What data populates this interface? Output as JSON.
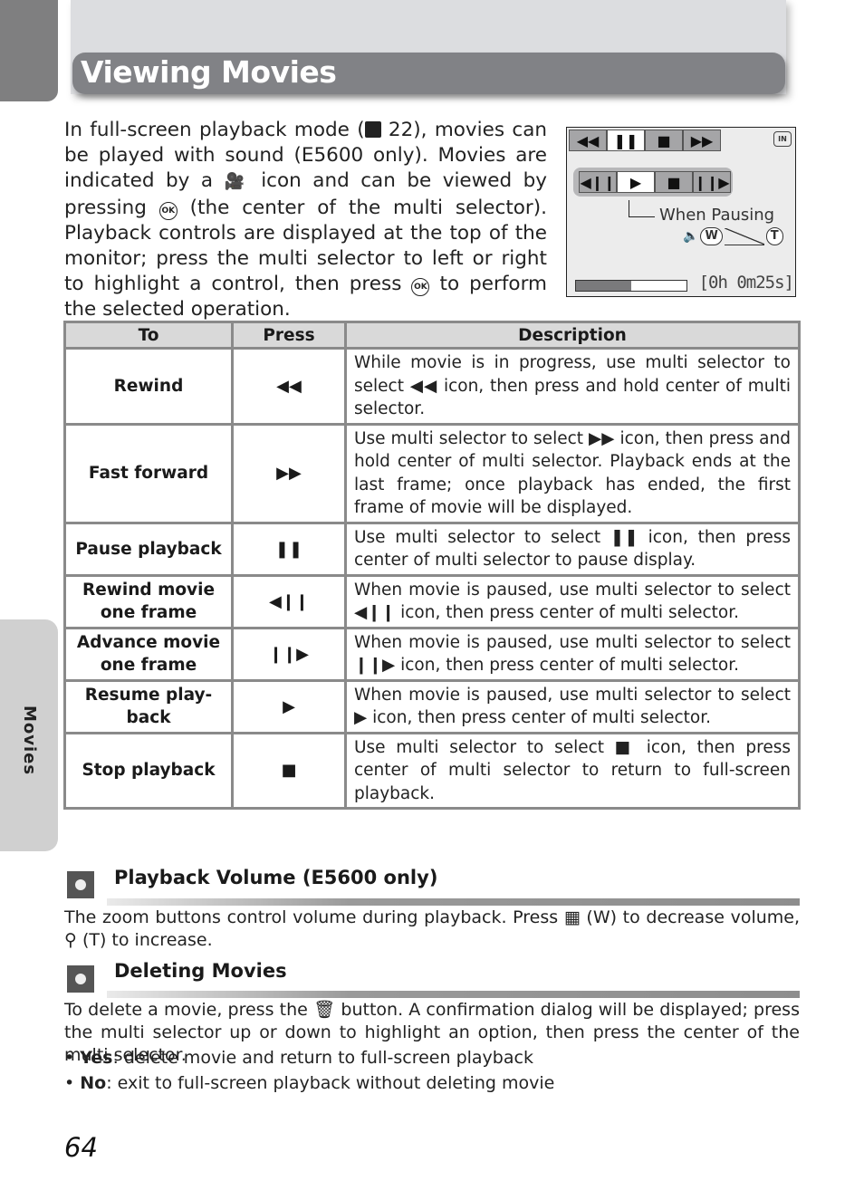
{
  "page": {
    "title": "Viewing Movies",
    "side_tab": "Movies",
    "page_number": "64"
  },
  "intro": {
    "part1": "In full-screen playback mode (",
    "ref_icon": "playback-mode-icon",
    "part2": " 22), movies can be played with sound (E5600 only). Movies are indicated by a ",
    "movie_icon": "movie-camera-icon",
    "part3": " icon and can be viewed by pressing ",
    "ok_label": "OK",
    "part4": " (the center of the multi selector). Playback controls are displayed at the top of the monitor; press the multi selector to left or right to highlight a control, then press ",
    "part5": " to perform the selected operation."
  },
  "monitor": {
    "top_controls": [
      {
        "icon": "rewind-icon",
        "glyph": "◀◀",
        "selected": false
      },
      {
        "icon": "pause-icon",
        "glyph": "❚❚",
        "selected": true
      },
      {
        "icon": "stop-icon",
        "glyph": "■",
        "selected": false
      },
      {
        "icon": "fast-forward-icon",
        "glyph": "▶▶",
        "selected": false
      }
    ],
    "pause_controls": [
      {
        "icon": "frame-back-icon",
        "glyph": "◀❙❙",
        "selected": false
      },
      {
        "icon": "play-icon",
        "glyph": "▶",
        "selected": true
      },
      {
        "icon": "stop-icon",
        "glyph": "■",
        "selected": false
      },
      {
        "icon": "frame-advance-icon",
        "glyph": "❙❙▶",
        "selected": false
      }
    ],
    "memory_label": "IN",
    "when_pausing_label": "When Pausing",
    "volume": {
      "wide": "W",
      "tele": "T"
    },
    "progress_fraction": 0.5,
    "timecode": "[0h 0m25s]"
  },
  "table": {
    "headers": [
      "To",
      "Press",
      "Description"
    ],
    "rows": [
      {
        "to": "Rewind",
        "press": "◀◀",
        "desc": "While movie is in progress, use multi selector to select ◀◀ icon, then press and hold center of multi selector."
      },
      {
        "to": "Fast forward",
        "press": "▶▶",
        "desc": "Use multi selector to select ▶▶ icon, then press and hold center of multi selector. Playback ends at the last frame; once playback has ended, the first frame of movie will be displayed."
      },
      {
        "to": "Pause playback",
        "press": "❚❚",
        "desc": "Use multi selector to select ❚❚ icon, then press center of multi selector to pause display."
      },
      {
        "to": "Rewind movie one frame",
        "press": "◀❙❙",
        "desc": "When movie is paused, use multi selector to select ◀❙❙ icon, then press center of multi selector."
      },
      {
        "to": "Advance movie one frame",
        "press": "❙❙▶",
        "desc": "When movie is paused, use multi selector to select ❙❙▶ icon, then press center of multi selector."
      },
      {
        "to": "Resume play-back",
        "press": "▶",
        "desc": "When movie is paused, use multi selector to select ▶ icon, then press center of multi selector."
      },
      {
        "to": "Stop playback",
        "press": "■",
        "desc": "Use multi selector to select ■ icon, then press center of multi selector to return to full-screen playback."
      }
    ]
  },
  "sections": {
    "volume": {
      "icon": "tip-lightbulb-icon",
      "title": "Playback Volume (E5600 only)",
      "text": "The zoom buttons control volume during playback. Press ▦ (W) to decrease volume, ⚲ (T) to increase."
    },
    "deleting": {
      "icon": "tip-lightbulb-icon",
      "title": "Deleting Movies",
      "text": "To delete a movie, press the 🗑 button. A confirmation dialog will be displayed; press the multi selector up or down to highlight an option, then press the center of the multi selector.",
      "bullets": [
        {
          "term": "Yes",
          "desc": ": delete movie and return to full-screen playback"
        },
        {
          "term": "No",
          "desc": ": exit to full-screen playback without deleting movie"
        }
      ]
    }
  }
}
